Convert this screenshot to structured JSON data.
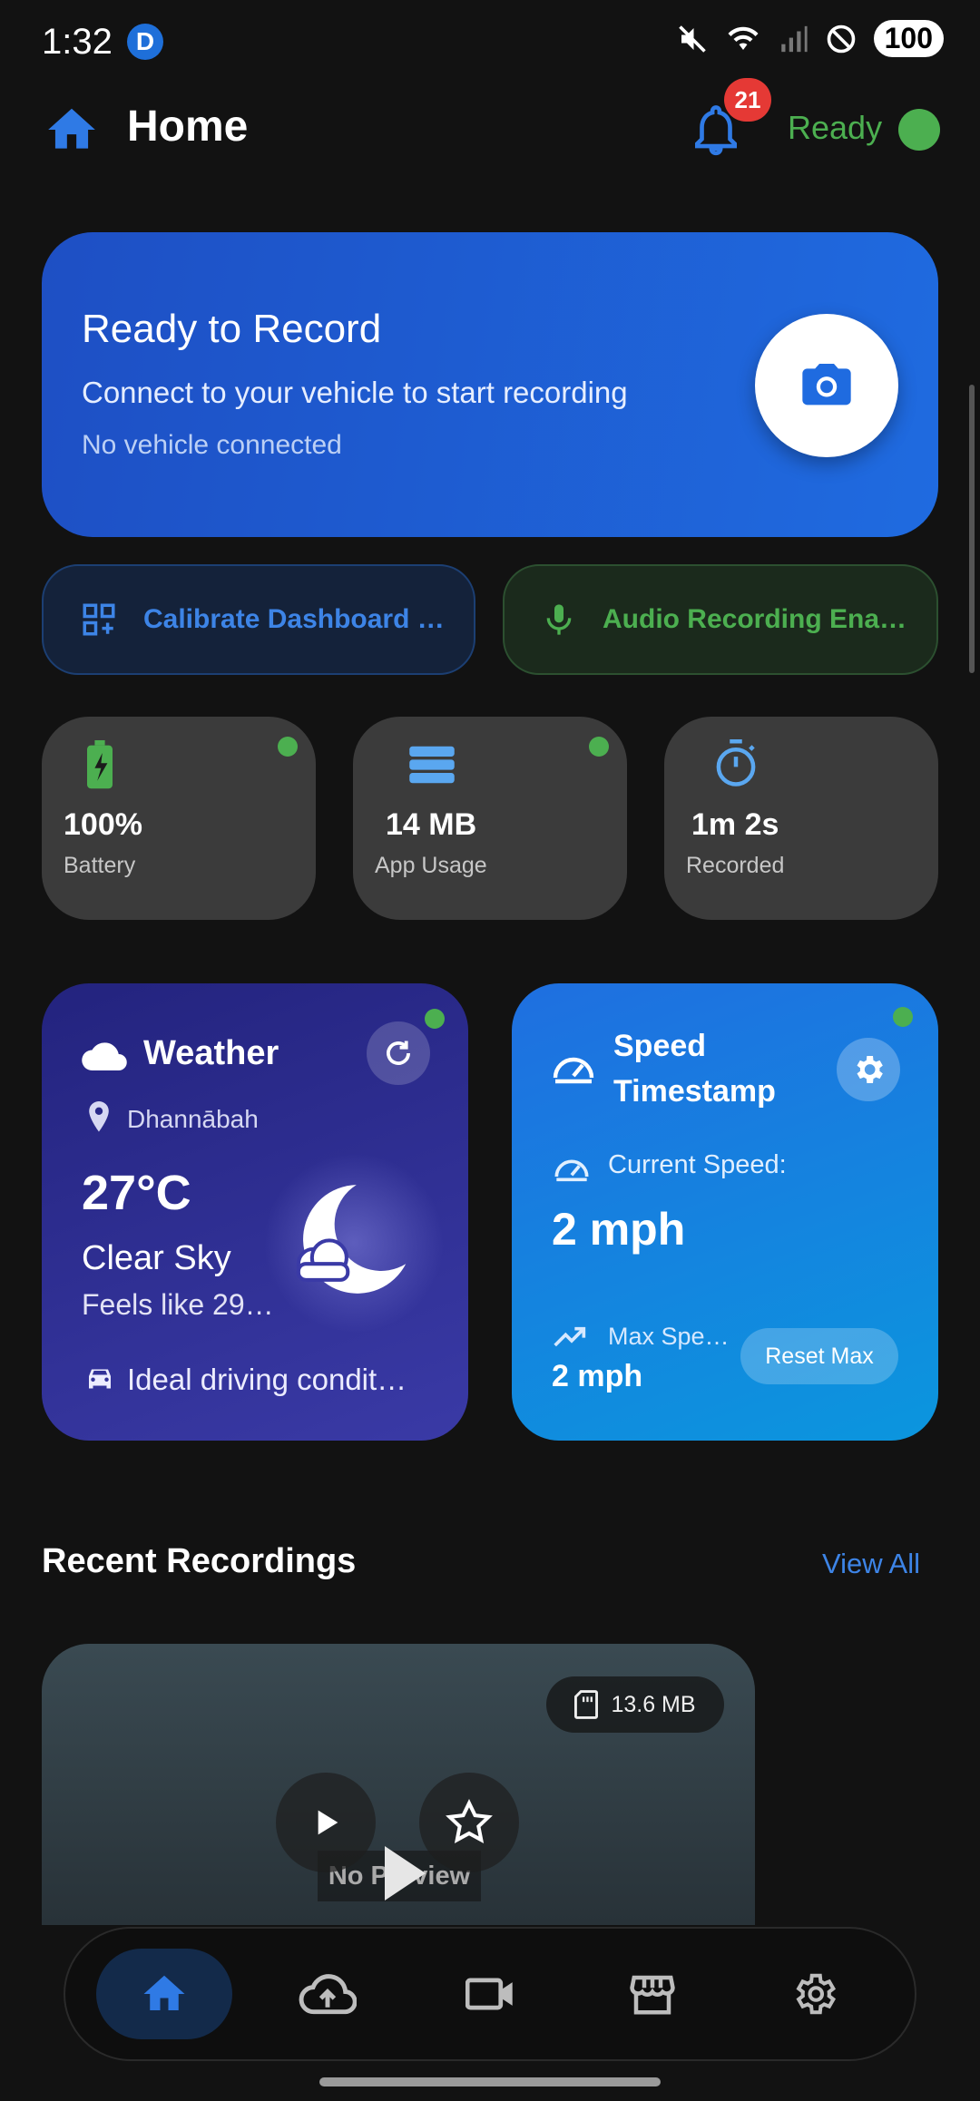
{
  "status_bar": {
    "time": "1:32",
    "app_icon_letter": "D",
    "battery": "100"
  },
  "header": {
    "title": "Home",
    "notification_count": "21",
    "status_text": "Ready"
  },
  "record_card": {
    "title": "Ready to Record",
    "subtitle": "Connect to your vehicle to start recording",
    "note": "No vehicle connected"
  },
  "actions": {
    "calibrate": "Calibrate Dashboard …",
    "audio": "Audio Recording Ena…"
  },
  "stats": [
    {
      "value": "100%",
      "label": "Battery",
      "icon": "battery-charging-icon"
    },
    {
      "value": "14 MB",
      "label": "App Usage",
      "icon": "storage-icon"
    },
    {
      "value": "1m 2s",
      "label": "Recorded",
      "icon": "timer-icon"
    }
  ],
  "weather": {
    "title": "Weather",
    "location": "Dhannābah",
    "temperature": "27°C",
    "description": "Clear Sky",
    "feels_like": "Feels like 29…",
    "driving": "Ideal driving condit…"
  },
  "speed": {
    "title_line1": "Speed",
    "title_line2": "Timestamp",
    "current_label": "Current Speed:",
    "current_value": "2 mph",
    "max_label": "Max Spe…",
    "max_value": "2 mph",
    "reset_label": "Reset Max"
  },
  "recent": {
    "title": "Recent Recordings",
    "view_all": "View All",
    "items": [
      {
        "size": "13.6 MB",
        "preview_text": "No Preview"
      }
    ]
  },
  "nav": [
    "home-icon",
    "cloud-upload-icon",
    "video-camera-icon",
    "store-icon",
    "settings-icon"
  ],
  "colors": {
    "accent": "#1f6be0",
    "success": "#4caf50",
    "danger": "#e53935",
    "background": "#121212"
  }
}
